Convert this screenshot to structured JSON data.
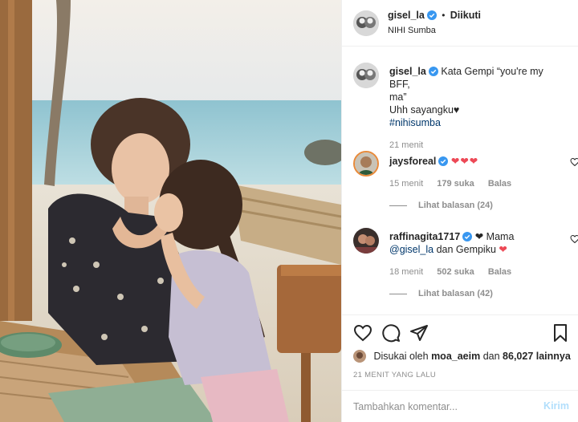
{
  "header": {
    "username": "gisel_la",
    "separator": "•",
    "follow_state": "Diikuti",
    "location": "NIHI Sumba"
  },
  "caption": {
    "username": "gisel_la",
    "text_line1": "Kata Gempi “you're my BFF,",
    "text_line2": "ma”",
    "text_line3": "Uhh sayangku♥",
    "hashtag": "#nihisumba",
    "time": "21 menit"
  },
  "comments": [
    {
      "username": "jaysforeal",
      "text": "❤❤❤",
      "time": "15 menit",
      "likes": "179 suka",
      "reply_label": "Balas",
      "view_replies": "Lihat balasan (24)"
    },
    {
      "username": "raffinagita1717",
      "text_a": "❤ Mama",
      "mention": "@gisel_la",
      "text_b": "dan Gempiku",
      "text_heart": "❤",
      "time": "18 menit",
      "likes": "502 suka",
      "reply_label": "Balas",
      "view_replies": "Lihat balasan (42)"
    }
  ],
  "actions": {
    "icons": [
      "heart-outline-icon",
      "comment-bubble-icon",
      "share-paper-plane-icon",
      "bookmark-icon"
    ],
    "liked_by_prefix": "Disukai oleh",
    "liked_by_user": "moa_aeim",
    "liked_by_connector": "dan",
    "liked_by_count": "86,027 lainnya",
    "timestamp": "21 MENIT YANG LALU"
  },
  "comment_box": {
    "placeholder": "Tambahkan komentar...",
    "post_label": "Kirim"
  },
  "colors": {
    "text": "#262626",
    "muted": "#8e8e8e",
    "link": "#00376b",
    "verified": "#3897f0",
    "heart": "#ed4956",
    "post_disabled": "#b2dffc",
    "border": "#efefef"
  }
}
